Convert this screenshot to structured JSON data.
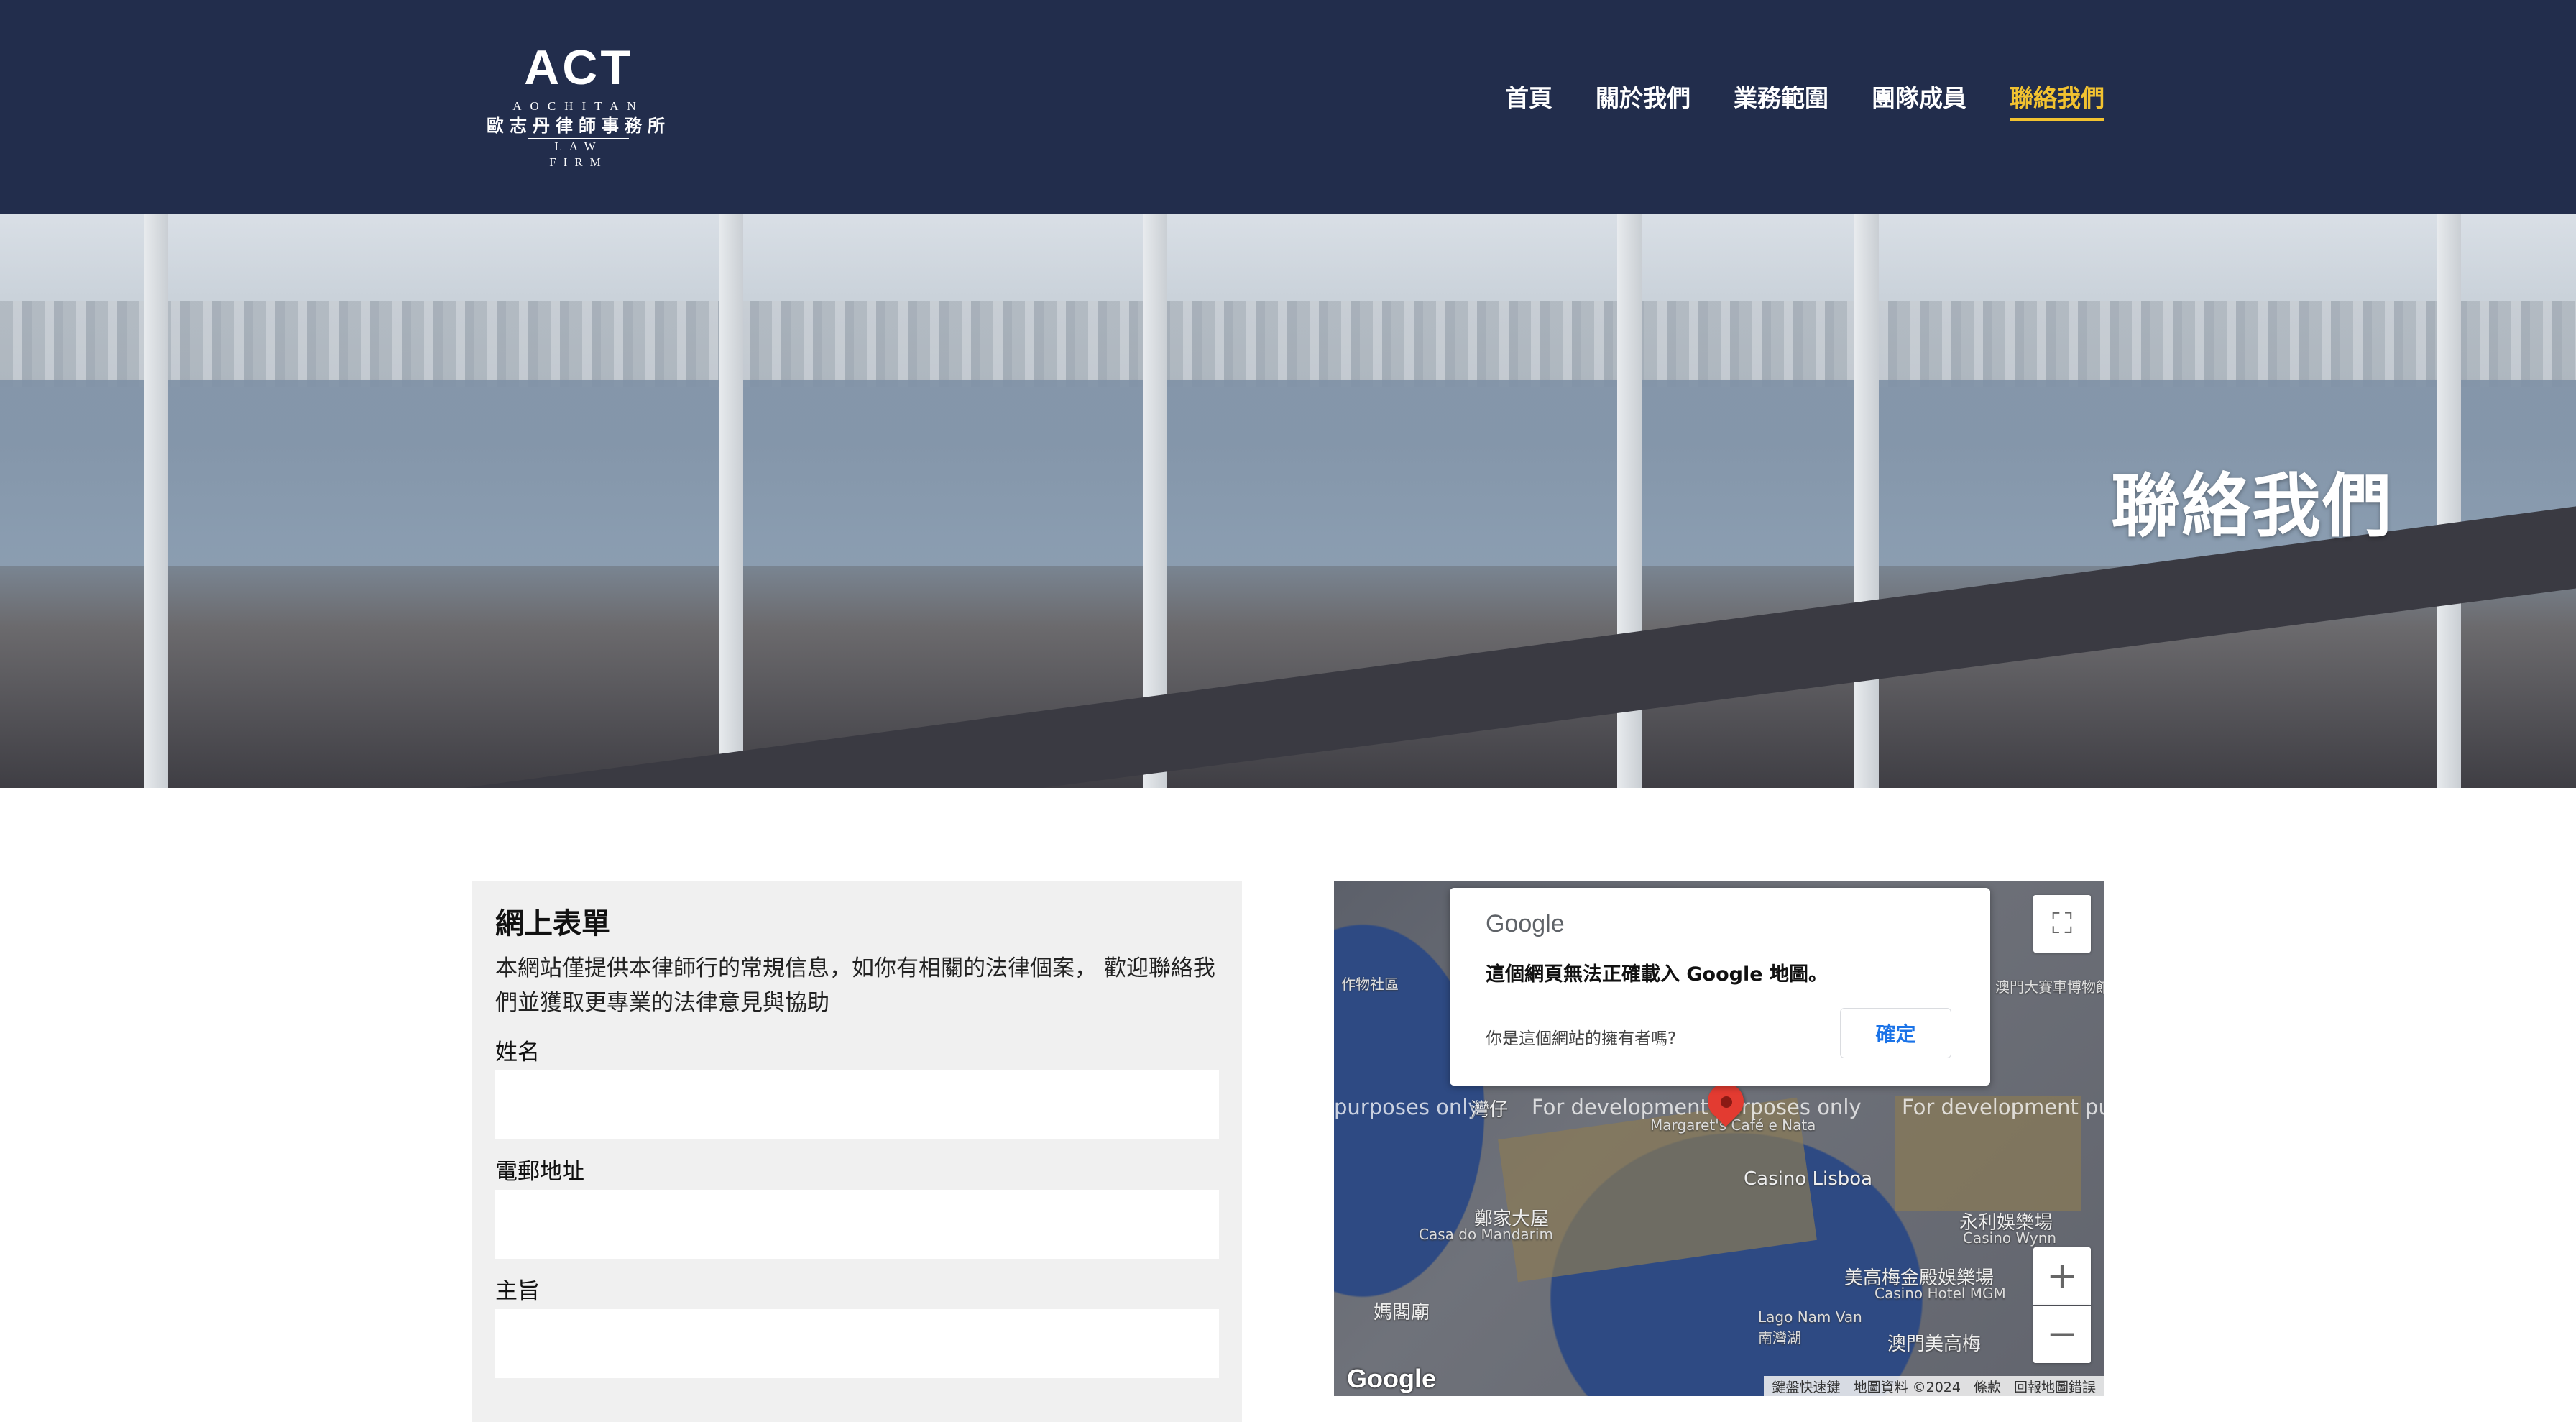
{
  "header": {
    "logo": {
      "mark": "ACT",
      "latin": "AOCHITAN",
      "chinese": "歐志丹律師事務所",
      "sub": "LAW FIRM"
    },
    "nav": [
      {
        "label": "首頁"
      },
      {
        "label": "關於我們"
      },
      {
        "label": "業務範圍"
      },
      {
        "label": "團隊成員"
      },
      {
        "label": "聯絡我們"
      }
    ],
    "accent_color": "#f2c230",
    "background_color": "#222d4c"
  },
  "hero": {
    "title": "聯絡我們"
  },
  "form": {
    "title": "網上表單",
    "description": "本網站僅提供本律師行的常規信息，如你有相關的法律個案， 歡迎聯絡我們並獲取更專業的法律意見與協助",
    "fields": [
      {
        "label": "姓名",
        "value": ""
      },
      {
        "label": "電郵地址",
        "value": ""
      },
      {
        "label": "主旨",
        "value": ""
      }
    ]
  },
  "map": {
    "dialog": {
      "brand": "Google",
      "message": "這個網頁無法正確載入 Google 地圖。",
      "question": "你是這個網站的擁有者嗎?",
      "ok_label": "確定"
    },
    "dev_watermarks": [
      "purposes only",
      "For development purposes only",
      "For development purp"
    ],
    "labels": [
      "灣仔",
      "Casino Lisboa",
      "澳門大賽車博物館",
      "永利娛樂場",
      "Casino Wynn",
      "美高梅金殿娛樂場",
      "Casino Hotel MGM",
      "澳門美高梅",
      "鄭家大屋",
      "Casa do Mandarim",
      "媽閣廟",
      "Lago Nam Van",
      "南灣湖",
      "作物社區",
      "Margaret's Café e Nata"
    ],
    "controls": {
      "fullscreen_icon": "⛶",
      "zoom_in_icon": "+",
      "zoom_out_icon": "−"
    },
    "google_logo": "Google",
    "footer": [
      "鍵盤快速鍵",
      "地圖資料 ©2024",
      "條款",
      "回報地圖錯誤"
    ]
  }
}
